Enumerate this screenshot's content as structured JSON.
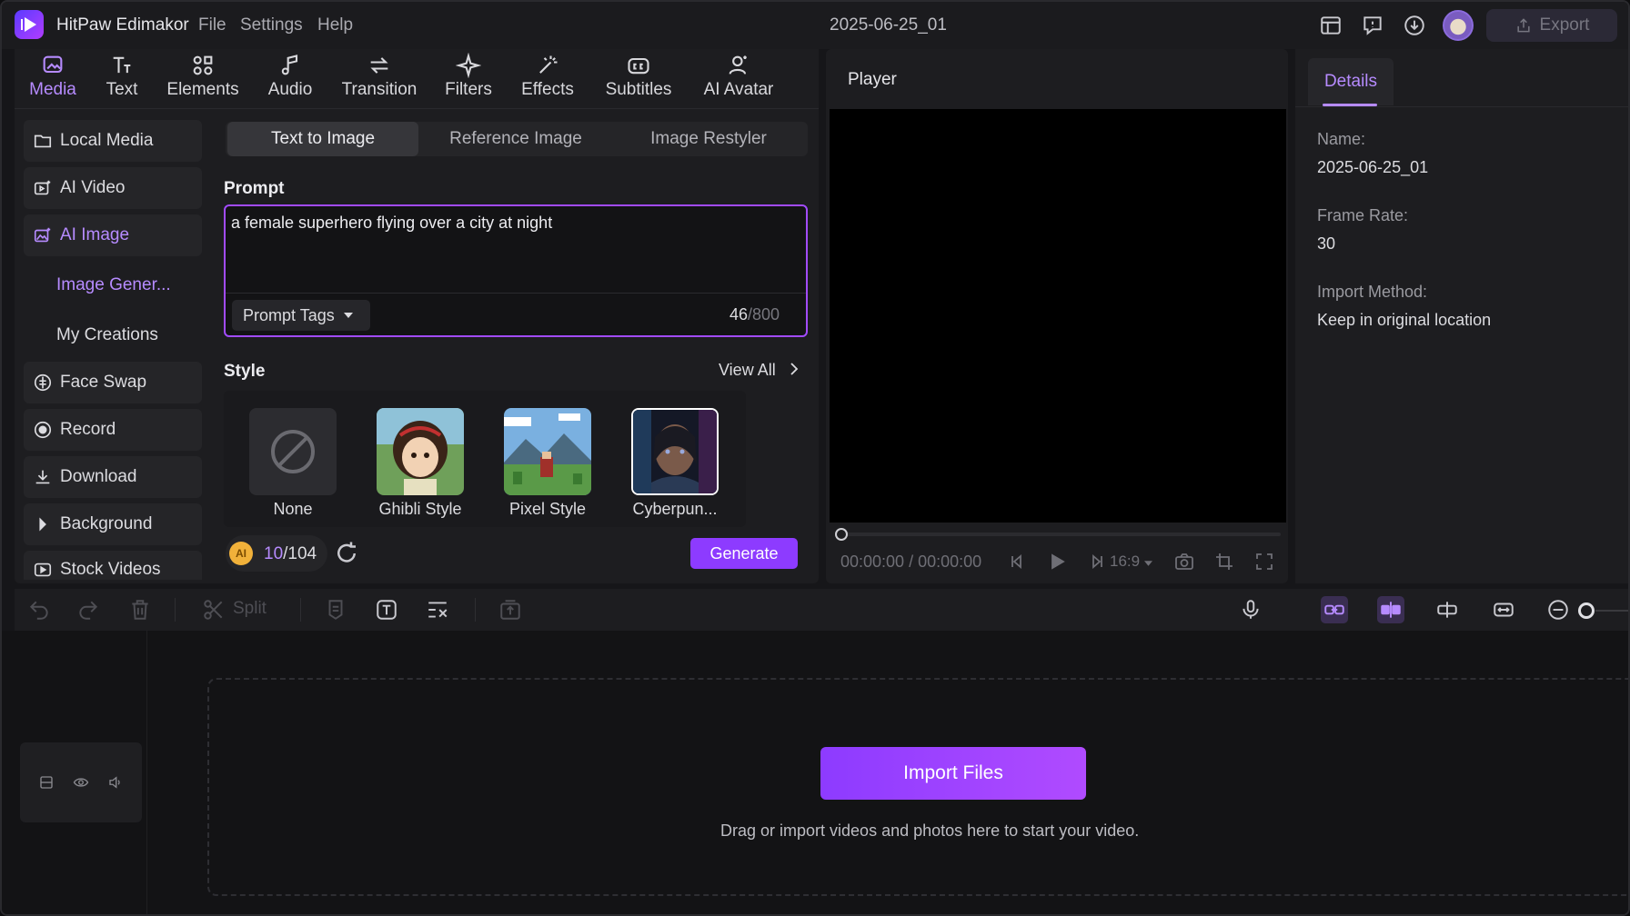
{
  "app": {
    "name": "HitPaw Edimakor",
    "project": "2025-06-25_01",
    "export_label": "Export"
  },
  "menu": [
    "File",
    "Settings",
    "Help"
  ],
  "top_tabs": [
    {
      "label": "Media",
      "icon": "media-icon",
      "active": true
    },
    {
      "label": "Text",
      "icon": "text-icon"
    },
    {
      "label": "Elements",
      "icon": "elements-icon"
    },
    {
      "label": "Audio",
      "icon": "audio-icon"
    },
    {
      "label": "Transition",
      "icon": "transition-icon"
    },
    {
      "label": "Filters",
      "icon": "filters-icon"
    },
    {
      "label": "Effects",
      "icon": "effects-icon"
    },
    {
      "label": "Subtitles",
      "icon": "subtitles-icon"
    },
    {
      "label": "AI Avatar",
      "icon": "ai-avatar-icon"
    }
  ],
  "sidebar": {
    "items": [
      {
        "label": "Local Media",
        "icon": "folder-icon"
      },
      {
        "label": "AI Video",
        "icon": "ai-video-icon"
      },
      {
        "label": "AI Image",
        "icon": "ai-image-icon",
        "active": true
      },
      {
        "label": "Image Gener...",
        "sub": true,
        "active": true
      },
      {
        "label": "My Creations",
        "sub": true
      },
      {
        "label": "Face Swap",
        "icon": "face-swap-icon"
      },
      {
        "label": "Record",
        "icon": "record-icon"
      },
      {
        "label": "Download",
        "icon": "download-icon"
      },
      {
        "label": "Background",
        "icon": "caret-right-icon"
      },
      {
        "label": "Stock Videos",
        "icon": "stock-video-icon"
      }
    ]
  },
  "subtabs": [
    "Text to Image",
    "Reference Image",
    "Image Restyler"
  ],
  "prompt": {
    "label": "Prompt",
    "value": "a female superhero flying over a city at night",
    "tags_label": "Prompt Tags",
    "count": "46",
    "max": "/800"
  },
  "style": {
    "label": "Style",
    "view_all": "View All",
    "options": [
      "None",
      "Ghibli Style",
      "Pixel Style",
      "Cyberpun..."
    ]
  },
  "credits": {
    "used": "10",
    "total": "/104",
    "coin_label": "AI"
  },
  "generate_label": "Generate",
  "player": {
    "title": "Player",
    "current": "00:00:00",
    "total": "/ 00:00:00",
    "ratio": "16:9"
  },
  "details": {
    "tab": "Details",
    "name_label": "Name:",
    "name_value": "2025-06-25_01",
    "fps_label": "Frame Rate:",
    "fps_value": "30",
    "import_label": "Import Method:",
    "import_value": "Keep in original location"
  },
  "timeline": {
    "split_label": "Split",
    "import_label": "Import Files",
    "hint": "Drag or import videos and photos here to start your video."
  },
  "colors": {
    "accent": "#b68bff",
    "button": "#8d3bff",
    "bg": "#161619"
  }
}
